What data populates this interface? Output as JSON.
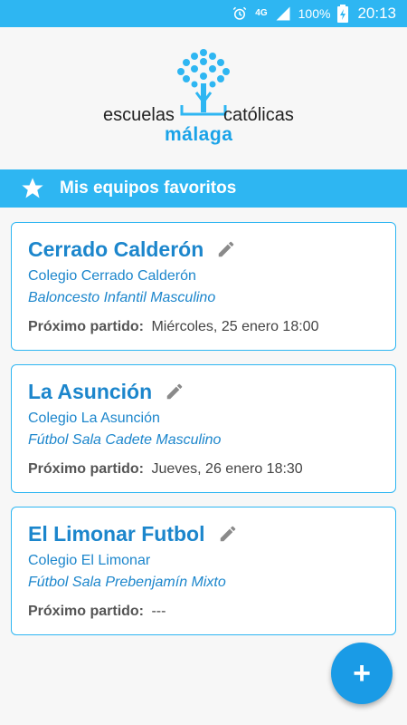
{
  "status_bar": {
    "network": "4G",
    "battery": "100%",
    "time": "20:13"
  },
  "logo": {
    "left_text": "escuelas",
    "right_text": "católicas",
    "city": "málaga",
    "tree_color": "#2eb6f2"
  },
  "favorites": {
    "title": "Mis equipos favoritos"
  },
  "teams": [
    {
      "name": "Cerrado Calderón",
      "school": "Colegio Cerrado Calderón",
      "category": "Baloncesto Infantil Masculino",
      "next_label": "Próximo partido:",
      "next_value": "Miércoles, 25 enero 18:00"
    },
    {
      "name": "La Asunción",
      "school": "Colegio La Asunción",
      "category": "Fútbol Sala Cadete Masculino",
      "next_label": "Próximo partido:",
      "next_value": "Jueves, 26 enero 18:30"
    },
    {
      "name": "El Limonar Futbol",
      "school": "Colegio El Limonar",
      "category": "Fútbol Sala Prebenjamín Mixto",
      "next_label": "Próximo partido:",
      "next_value": "---"
    }
  ],
  "fab": {
    "label": "+"
  },
  "colors": {
    "accent": "#2eb6f2",
    "team_text": "#1c86cc",
    "fab": "#1a9be6"
  }
}
